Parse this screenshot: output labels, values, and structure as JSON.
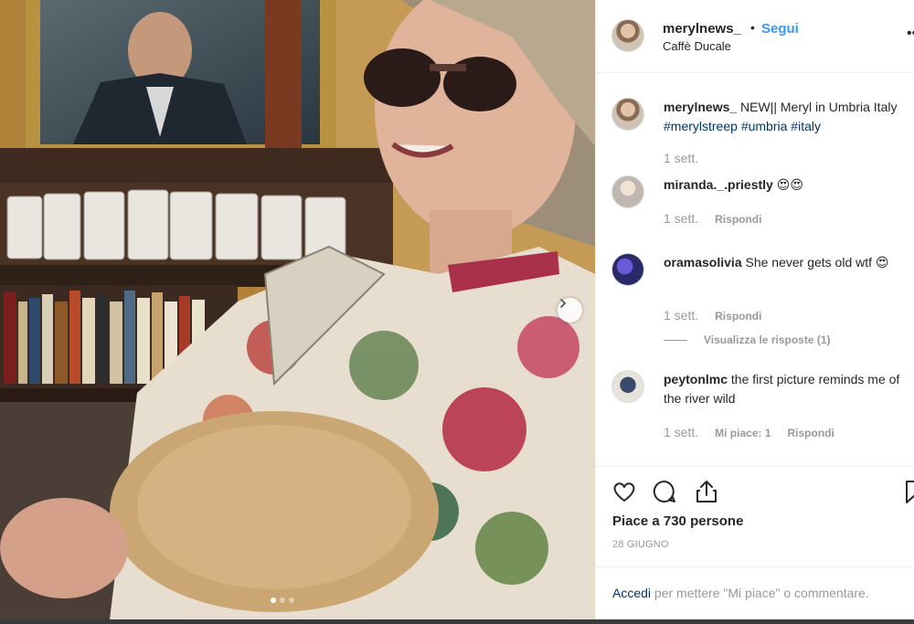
{
  "header": {
    "username": "merylnews_",
    "separator": "•",
    "follow_label": "Segui",
    "location": "Caffè Ducale",
    "more_glyph": "••"
  },
  "caption": {
    "username": "merylnews_",
    "text_prefix": " NEW|| Meryl in Umbria Italy ",
    "hashtags": [
      "#merylstreep",
      "#umbria",
      "#italy"
    ],
    "time": "1 sett."
  },
  "comments": [
    {
      "username": "miranda._.priestly",
      "text": " 😍😍",
      "time": "1 sett.",
      "likes_label": "",
      "reply_label": "Rispondi"
    },
    {
      "username": "oramasolivia",
      "text": " She never gets old wtf 😍",
      "time": "1 sett.",
      "likes_label": "",
      "reply_label": "Rispondi",
      "view_replies_label": "Visualizza le risposte (1)"
    },
    {
      "username": "peytonlmc",
      "text": " the first picture reminds me of the river wild",
      "time": "1 sett.",
      "likes_label": "Mi piace: 1",
      "reply_label": "Rispondi"
    }
  ],
  "actions": {
    "icons": [
      "heart-icon",
      "comment-icon",
      "share-icon",
      "bookmark-icon"
    ],
    "likes_text": "Piace a 730 persone",
    "date": "28 GIUGNO"
  },
  "login": {
    "link_label": "Accedi",
    "rest_text": " per mettere \"Mi piace\" o commentare."
  },
  "carousel": {
    "active_index": 0,
    "total": 3
  },
  "colors": {
    "accent_blue": "#3897f0",
    "link_dark_blue": "#003569",
    "meta_gray": "#999999",
    "border": "#efefef"
  }
}
